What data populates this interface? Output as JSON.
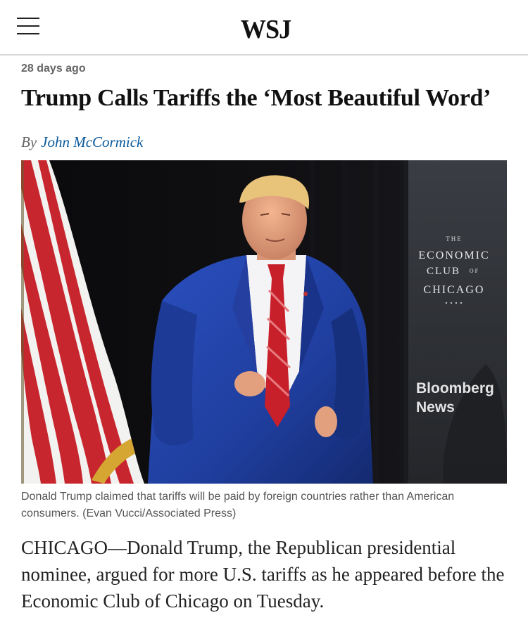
{
  "header": {
    "logo_text": "WSJ",
    "menu_icon": "hamburger-menu-icon"
  },
  "article": {
    "timestamp": "28 days ago",
    "headline": "Trump Calls Tariffs the ‘Most Beautiful Word’",
    "byline_prefix": "By",
    "author": "John McCormick",
    "image": {
      "alt": "Donald Trump claimed that tariffs will be paid by foreign countries rather than American consumers.",
      "backdrop_text": {
        "the": "THE",
        "economic": "ECONOMIC",
        "club_of": "CLUB",
        "of": "OF",
        "chicago": "CHICAGO",
        "bloomberg": "Bloomberg",
        "news": "News"
      }
    },
    "caption": "Donald Trump claimed that tariffs will be paid by foreign countries rather than American consumers. (Evan Vucci/Associated Press)",
    "body_paragraph": "CHICAGO—Donald Trump, the Republican presidential nominee, argued for more U.S. tariffs as he appeared before the Economic Club of Chicago on Tuesday."
  },
  "colors": {
    "author_link": "#0a5a9c",
    "meta_gray": "#666666",
    "divider": "#d9d9d9",
    "suit_blue": "#1f3e9e",
    "tie_red": "#c8202a"
  }
}
